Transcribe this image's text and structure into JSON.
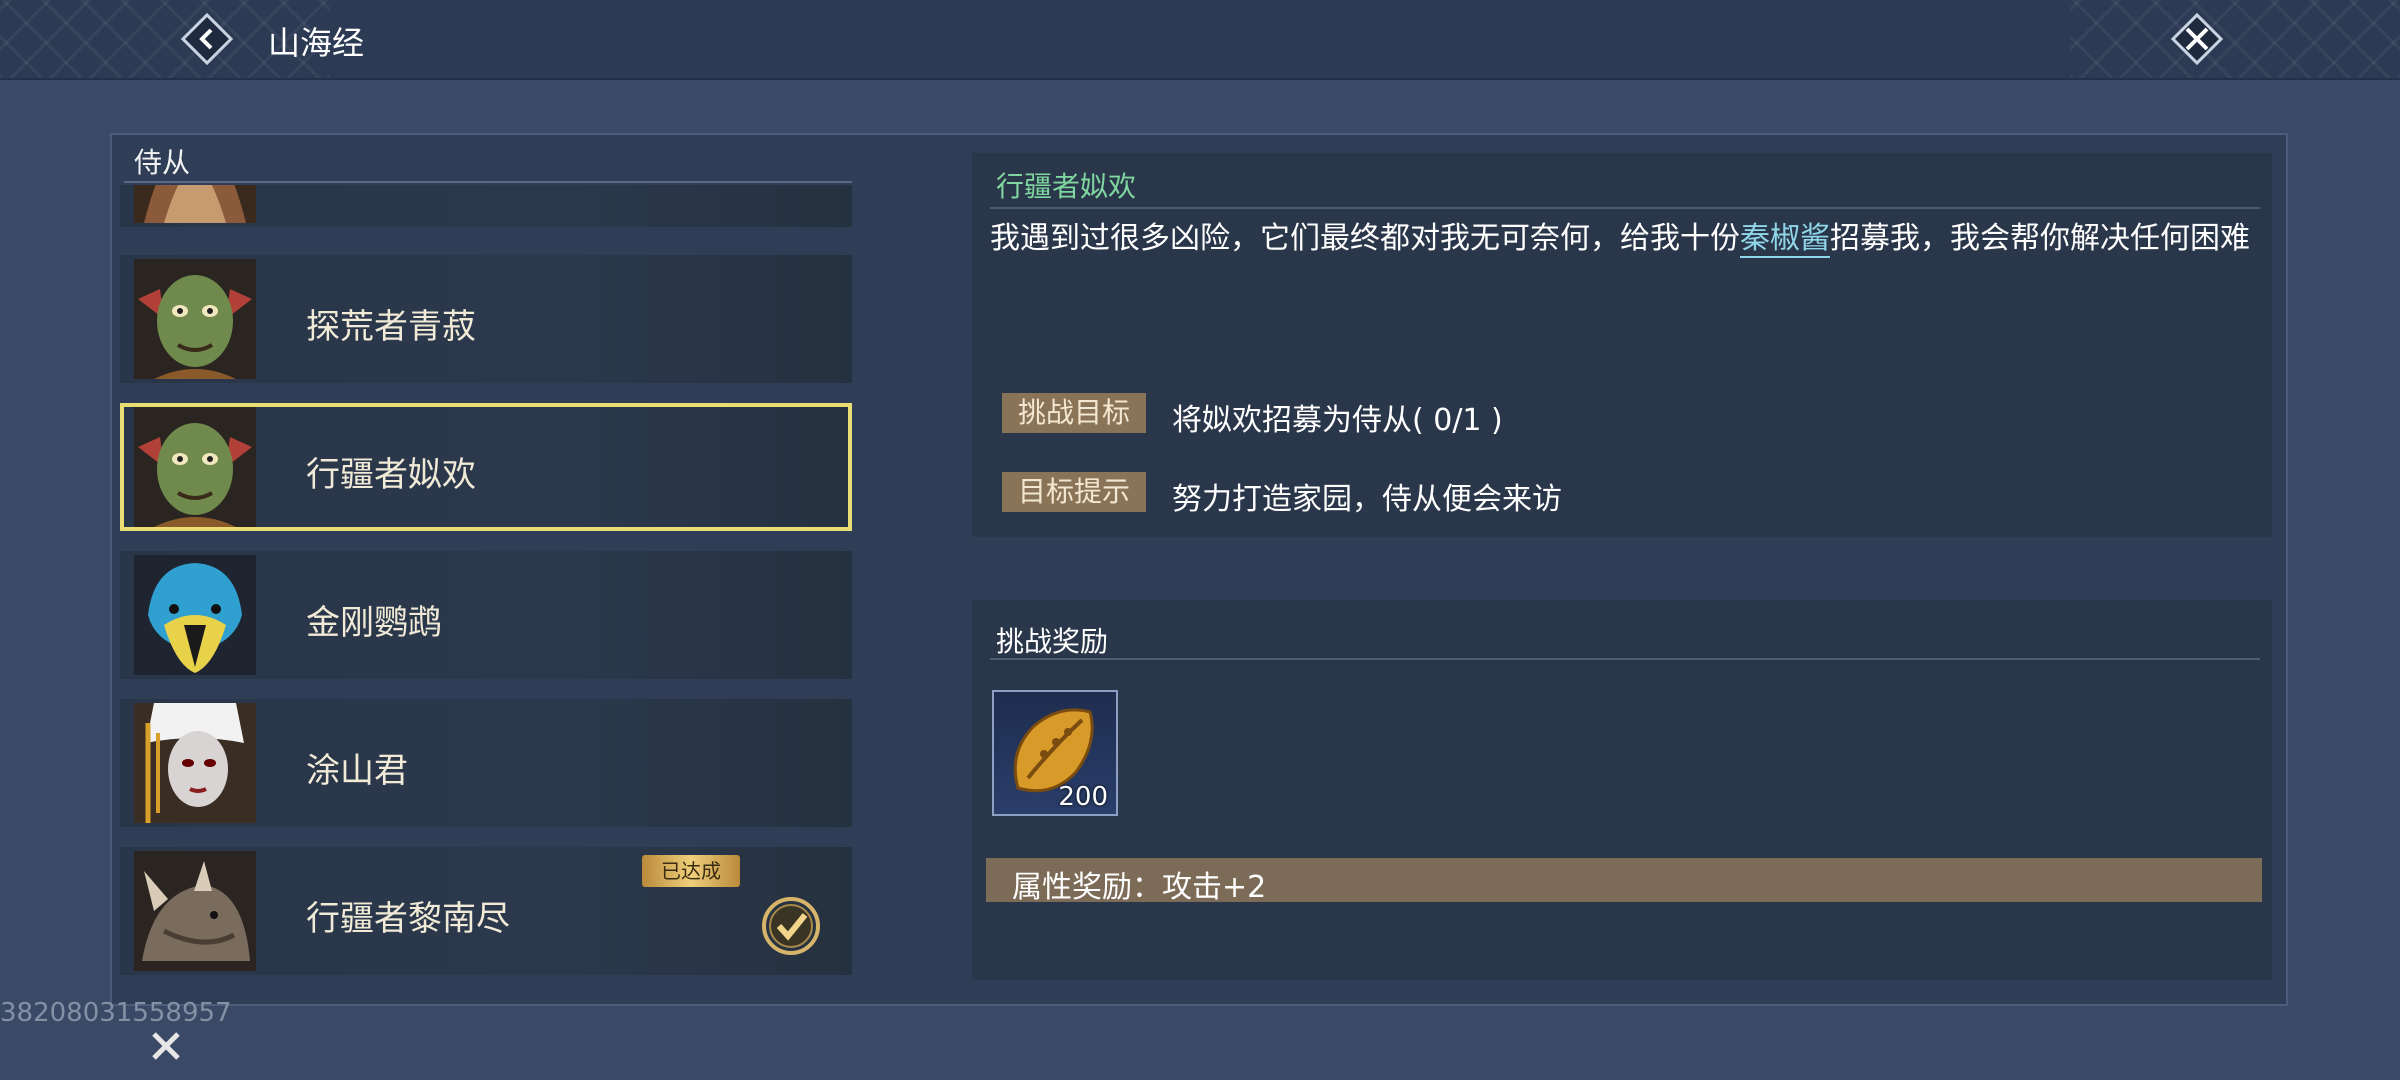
{
  "header": {
    "title": "山海经"
  },
  "list": {
    "heading": "侍从",
    "items": [
      {
        "name": "",
        "selected": false
      },
      {
        "name": "探荒者青菽",
        "selected": false
      },
      {
        "name": "行疆者姒欢",
        "selected": true
      },
      {
        "name": "金刚鹦鹉",
        "selected": false
      },
      {
        "name": "涂山君",
        "selected": false
      },
      {
        "name": "行疆者黎南尽",
        "selected": false,
        "badge": "已达成",
        "completed": true
      }
    ]
  },
  "detail": {
    "title": "行疆者姒欢",
    "desc_before": "我遇到过很多凶险，它们最终都对我无可奈何，给我十份",
    "desc_highlight": "秦椒酱",
    "desc_after": "招募我，我会帮你解决任何困难",
    "goal_label": "挑战目标",
    "goal_text": "将姒欢招募为侍从( 0/1 )",
    "hint_label": "目标提示",
    "hint_text": "努力打造家园，侍从便会来访"
  },
  "reward": {
    "title": "挑战奖励",
    "item_icon": "golden-seed-icon",
    "item_count": "200",
    "attr_text": "属性奖励：攻击+2"
  },
  "footer": {
    "uid": "38208031558957"
  },
  "colors": {
    "accent_green": "#7fd6a0",
    "selected_border": "#e9de73",
    "tag_bg": "#8a7458"
  }
}
